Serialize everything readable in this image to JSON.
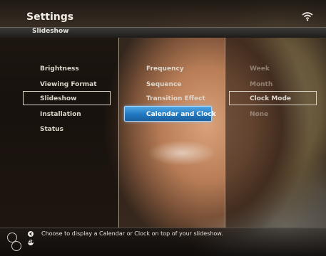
{
  "header": {
    "title": "Settings",
    "subtitle": "Slideshow"
  },
  "menu": {
    "items": [
      "Brightness",
      "Viewing Format",
      "Slideshow",
      "Installation",
      "Status"
    ],
    "selected": "Slideshow"
  },
  "submenu": {
    "items": [
      "Frequency",
      "Sequence",
      "Transition Effect",
      "Calendar and Clock"
    ],
    "highlighted": "Calendar and Clock"
  },
  "options": {
    "items": [
      "Week",
      "Month",
      "Clock Mode",
      "None"
    ],
    "selected": "Clock Mode"
  },
  "footer": {
    "hint": "Choose to display a Calendar or Clock on top of your slideshow.",
    "button_glyph": "OK"
  },
  "icons": [
    "wifi-icon",
    "nav-ring-icon",
    "back-button-icon",
    "ok-button-icon"
  ],
  "colors": {
    "highlight": "#2a86cf",
    "text": "#ddd6cc"
  }
}
